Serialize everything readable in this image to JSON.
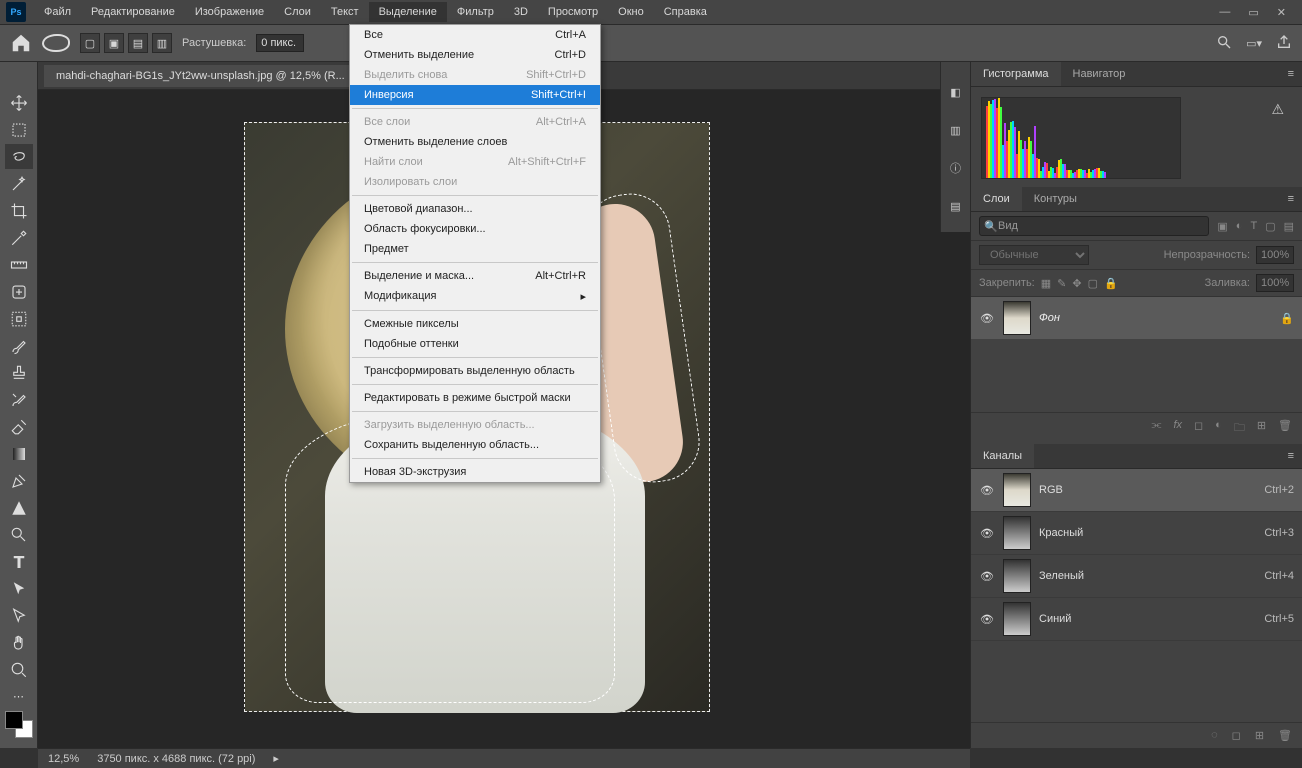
{
  "menu": [
    "Файл",
    "Редактирование",
    "Изображение",
    "Слои",
    "Текст",
    "Выделение",
    "Фильтр",
    "3D",
    "Просмотр",
    "Окно",
    "Справка"
  ],
  "active_menu_index": 5,
  "doc_tab": "mahdi-chaghari-BG1s_JYt2ww-unsplash.jpg @ 12,5% (R...",
  "options": {
    "feather_label": "Растушевка:",
    "feather_value": "0 пикс."
  },
  "dropdown": [
    {
      "label": "Все",
      "shortcut": "Ctrl+A"
    },
    {
      "label": "Отменить выделение",
      "shortcut": "Ctrl+D"
    },
    {
      "label": "Выделить снова",
      "shortcut": "Shift+Ctrl+D",
      "disabled": true
    },
    {
      "label": "Инверсия",
      "shortcut": "Shift+Ctrl+I",
      "highlight": true
    },
    {
      "sep": true
    },
    {
      "label": "Все слои",
      "shortcut": "Alt+Ctrl+A",
      "disabled": true
    },
    {
      "label": "Отменить выделение слоев"
    },
    {
      "label": "Найти слои",
      "shortcut": "Alt+Shift+Ctrl+F",
      "disabled": true
    },
    {
      "label": "Изолировать слои",
      "disabled": true
    },
    {
      "sep": true
    },
    {
      "label": "Цветовой диапазон..."
    },
    {
      "label": "Область фокусировки..."
    },
    {
      "label": "Предмет"
    },
    {
      "sep": true
    },
    {
      "label": "Выделение и маска...",
      "shortcut": "Alt+Ctrl+R"
    },
    {
      "label": "Модификация",
      "submenu": true
    },
    {
      "sep": true
    },
    {
      "label": "Смежные пикселы"
    },
    {
      "label": "Подобные оттенки"
    },
    {
      "sep": true
    },
    {
      "label": "Трансформировать выделенную область"
    },
    {
      "sep": true
    },
    {
      "label": "Редактировать в режиме быстрой маски"
    },
    {
      "sep": true
    },
    {
      "label": "Загрузить выделенную область...",
      "disabled": true
    },
    {
      "label": "Сохранить выделенную область..."
    },
    {
      "sep": true
    },
    {
      "label": "Новая 3D-экструзия"
    }
  ],
  "panel_histogram": {
    "tabs": [
      "Гистограмма",
      "Навигатор"
    ],
    "active": 0
  },
  "panel_layers": {
    "tabs": [
      "Слои",
      "Контуры"
    ],
    "active": 0,
    "filter_placeholder": "Вид",
    "blend_mode": "Обычные",
    "opacity_label": "Непрозрачность:",
    "opacity_value": "100%",
    "lock_label": "Закрепить:",
    "fill_label": "Заливка:",
    "fill_value": "100%",
    "layer_name": "Фон"
  },
  "panel_channels": {
    "tab": "Каналы",
    "rows": [
      {
        "name": "RGB",
        "shortcut": "Ctrl+2"
      },
      {
        "name": "Красный",
        "shortcut": "Ctrl+3"
      },
      {
        "name": "Зеленый",
        "shortcut": "Ctrl+4"
      },
      {
        "name": "Синий",
        "shortcut": "Ctrl+5"
      }
    ]
  },
  "status": {
    "zoom": "12,5%",
    "dims": "3750 пикс. x 4688 пикс. (72 ppi)"
  }
}
